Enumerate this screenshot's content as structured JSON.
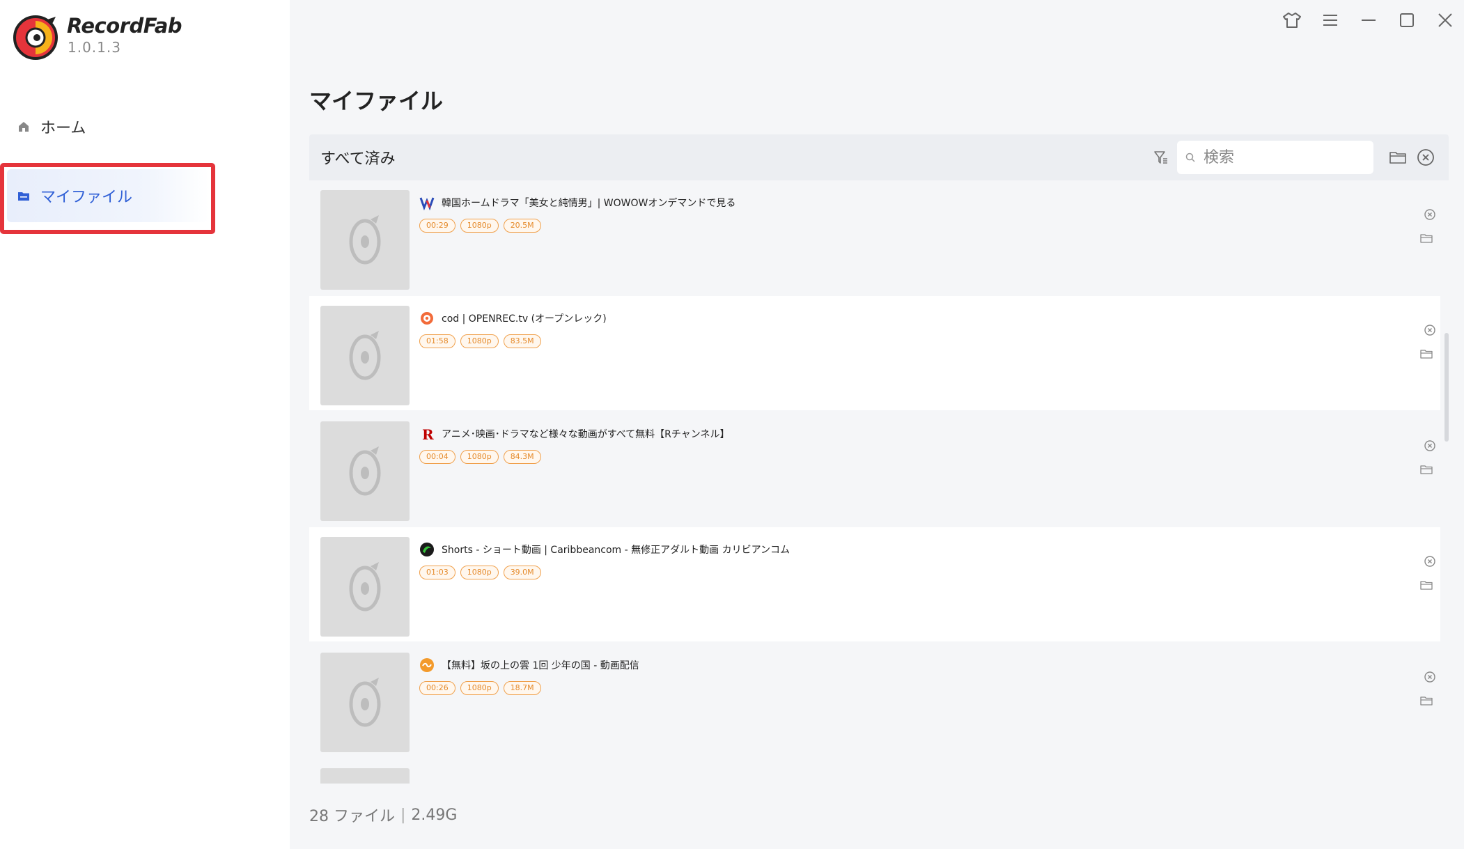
{
  "app": {
    "name": "RecordFab",
    "version": "1.0.1.3"
  },
  "nav": {
    "home": "ホーム",
    "my_files": "マイファイル"
  },
  "page": {
    "title": "マイファイル",
    "filter_label": "すべて済み",
    "search_placeholder": "検索"
  },
  "files": [
    {
      "site_icon": "wowow-icon",
      "title": "韓国ホームドラマ「美女と純情男」| WOWOWオンデマンドで見る",
      "duration": "00:29",
      "resolution": "1080p",
      "size": "20.5M"
    },
    {
      "site_icon": "openrec-icon",
      "title": "cod | OPENREC.tv (オープンレック)",
      "duration": "01:58",
      "resolution": "1080p",
      "size": "83.5M"
    },
    {
      "site_icon": "rakuten-r-icon",
      "title": "アニメ･映画･ドラマなど様々な動画がすべて無料【Rチャンネル】",
      "duration": "00:04",
      "resolution": "1080p",
      "size": "84.3M"
    },
    {
      "site_icon": "caribbeancom-icon",
      "title": "Shorts - ショート動画 | Caribbeancom - 無修正アダルト動画 カリビアンコム",
      "duration": "01:03",
      "resolution": "1080p",
      "size": "39.0M"
    },
    {
      "site_icon": "shonen-no-kuni-icon",
      "title": "【無料】坂の上の雲 1回 少年の国 - 動画配信",
      "duration": "00:26",
      "resolution": "1080p",
      "size": "18.7M"
    }
  ],
  "footer": {
    "file_count": "28 ファイル",
    "total_size": "2.49G"
  },
  "colors": {
    "accent": "#2f5fd6",
    "highlight": "#e5343b",
    "tag": "#f0a04b"
  }
}
